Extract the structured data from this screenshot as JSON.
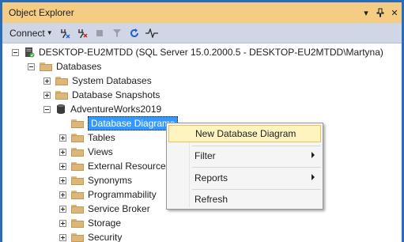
{
  "window": {
    "title": "Object Explorer",
    "title_buttons": [
      "▾",
      "⊣",
      "✕"
    ],
    "accent": "#f5cc84",
    "border_color": "#2b6cb8"
  },
  "toolbar": {
    "connect_label": "Connect",
    "icons": [
      "connect-dropdown-icon",
      "connect-icon",
      "disconnect-icon",
      "stop-icon",
      "filter-icon",
      "refresh-icon",
      "activity-monitor-icon"
    ]
  },
  "tree": {
    "server": "DESKTOP-EU2MTDD (SQL Server 15.0.2000.5 - DESKTOP-EU2MTDD\\Martyna)",
    "databases": "Databases",
    "system_databases": "System Databases",
    "database_snapshots": "Database Snapshots",
    "adventureworks": "AdventureWorks2019",
    "database_diagrams": "Database Diagrams",
    "tables": "Tables",
    "views": "Views",
    "external_resources": "External Resources",
    "synonyms": "Synonyms",
    "programmability": "Programmability",
    "service_broker": "Service Broker",
    "storage": "Storage",
    "security": "Security"
  },
  "context_menu": {
    "new_diagram": "New Database Diagram",
    "filter": "Filter",
    "reports": "Reports",
    "refresh": "Refresh"
  }
}
